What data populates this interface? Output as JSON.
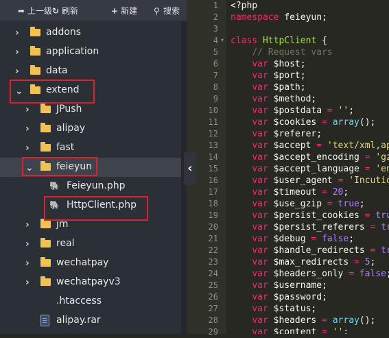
{
  "toolbar": {
    "up": "上一级",
    "refresh": "刷新",
    "new": "新建",
    "search": "搜索"
  },
  "tree": [
    {
      "label": "addons",
      "type": "folder",
      "depth": 0,
      "expanded": false
    },
    {
      "label": "application",
      "type": "folder",
      "depth": 0,
      "expanded": false
    },
    {
      "label": "data",
      "type": "folder",
      "depth": 0,
      "expanded": false
    },
    {
      "label": "extend",
      "type": "folder",
      "depth": 0,
      "expanded": true
    },
    {
      "label": "JPush",
      "type": "folder",
      "depth": 1,
      "expanded": false
    },
    {
      "label": "alipay",
      "type": "folder",
      "depth": 1,
      "expanded": false
    },
    {
      "label": "fast",
      "type": "folder",
      "depth": 1,
      "expanded": false
    },
    {
      "label": "feieyun",
      "type": "folder",
      "depth": 1,
      "expanded": true
    },
    {
      "label": "Feieyun.php",
      "type": "php",
      "depth": 2
    },
    {
      "label": "HttpClient.php",
      "type": "php",
      "depth": 2
    },
    {
      "label": "jm",
      "type": "folder",
      "depth": 1,
      "expanded": false
    },
    {
      "label": "real",
      "type": "folder",
      "depth": 1,
      "expanded": false
    },
    {
      "label": "wechatpay",
      "type": "folder",
      "depth": 1,
      "expanded": false
    },
    {
      "label": "wechatpayv3",
      "type": "folder",
      "depth": 1,
      "expanded": false
    },
    {
      "label": ".htaccess",
      "type": "file",
      "depth": 1
    },
    {
      "label": "alipay.rar",
      "type": "rar",
      "depth": 1
    }
  ],
  "editor": {
    "lines": [
      [
        [
          "p",
          "<?php"
        ]
      ],
      [
        [
          "kw",
          "namespace"
        ],
        [
          "p",
          " feieyun;"
        ]
      ],
      [],
      [
        [
          "kw",
          "class"
        ],
        [
          "p",
          " "
        ],
        [
          "cls",
          "HttpClient"
        ],
        [
          "p",
          " {"
        ]
      ],
      [
        [
          "p",
          "    "
        ],
        [
          "cm",
          "// Request vars"
        ]
      ],
      [
        [
          "p",
          "    "
        ],
        [
          "kw",
          "var"
        ],
        [
          "p",
          " $host;"
        ]
      ],
      [
        [
          "p",
          "    "
        ],
        [
          "kw",
          "var"
        ],
        [
          "p",
          " $port;"
        ]
      ],
      [
        [
          "p",
          "    "
        ],
        [
          "kw",
          "var"
        ],
        [
          "p",
          " $path;"
        ]
      ],
      [
        [
          "p",
          "    "
        ],
        [
          "kw",
          "var"
        ],
        [
          "p",
          " $method;"
        ]
      ],
      [
        [
          "p",
          "    "
        ],
        [
          "kw",
          "var"
        ],
        [
          "p",
          " $postdata "
        ],
        [
          "kw",
          "="
        ],
        [
          "p",
          " "
        ],
        [
          "st",
          "''"
        ],
        [
          "p",
          ";"
        ]
      ],
      [
        [
          "p",
          "    "
        ],
        [
          "kw",
          "var"
        ],
        [
          "p",
          " $cookies "
        ],
        [
          "kw",
          "="
        ],
        [
          "p",
          " "
        ],
        [
          "fn",
          "array"
        ],
        [
          "p",
          "();"
        ]
      ],
      [
        [
          "p",
          "    "
        ],
        [
          "kw",
          "var"
        ],
        [
          "p",
          " $referer;"
        ]
      ],
      [
        [
          "p",
          "    "
        ],
        [
          "kw",
          "var"
        ],
        [
          "p",
          " $accept "
        ],
        [
          "kw",
          "="
        ],
        [
          "p",
          " "
        ],
        [
          "st",
          "'text/xml,ap"
        ]
      ],
      [
        [
          "p",
          "    "
        ],
        [
          "kw",
          "var"
        ],
        [
          "p",
          " $accept_encoding "
        ],
        [
          "kw",
          "="
        ],
        [
          "p",
          " "
        ],
        [
          "st",
          "'gz"
        ]
      ],
      [
        [
          "p",
          "    "
        ],
        [
          "kw",
          "var"
        ],
        [
          "p",
          " $accept_language "
        ],
        [
          "kw",
          "="
        ],
        [
          "p",
          " "
        ],
        [
          "st",
          "'en"
        ]
      ],
      [
        [
          "p",
          "    "
        ],
        [
          "kw",
          "var"
        ],
        [
          "p",
          " $user_agent "
        ],
        [
          "kw",
          "="
        ],
        [
          "p",
          " "
        ],
        [
          "st",
          "'Incutio"
        ]
      ],
      [
        [
          "p",
          "    "
        ],
        [
          "kw",
          "var"
        ],
        [
          "p",
          " $timeout "
        ],
        [
          "kw",
          "="
        ],
        [
          "p",
          " "
        ],
        [
          "nm",
          "20"
        ],
        [
          "p",
          ";"
        ]
      ],
      [
        [
          "p",
          "    "
        ],
        [
          "kw",
          "var"
        ],
        [
          "p",
          " $use_gzip "
        ],
        [
          "kw",
          "="
        ],
        [
          "p",
          " "
        ],
        [
          "ct",
          "true"
        ],
        [
          "p",
          ";"
        ]
      ],
      [
        [
          "p",
          "    "
        ],
        [
          "kw",
          "var"
        ],
        [
          "p",
          " $persist_cookies "
        ],
        [
          "kw",
          "="
        ],
        [
          "p",
          " "
        ],
        [
          "ct",
          "tru"
        ]
      ],
      [
        [
          "p",
          "    "
        ],
        [
          "kw",
          "var"
        ],
        [
          "p",
          " $persist_referers "
        ],
        [
          "kw",
          "="
        ],
        [
          "p",
          " "
        ],
        [
          "ct",
          "tr"
        ]
      ],
      [
        [
          "p",
          "    "
        ],
        [
          "kw",
          "var"
        ],
        [
          "p",
          " $debug "
        ],
        [
          "kw",
          "="
        ],
        [
          "p",
          " "
        ],
        [
          "ct",
          "false"
        ],
        [
          "p",
          ";"
        ]
      ],
      [
        [
          "p",
          "    "
        ],
        [
          "kw",
          "var"
        ],
        [
          "p",
          " $handle_redirects "
        ],
        [
          "kw",
          "="
        ],
        [
          "p",
          " "
        ],
        [
          "ct",
          "tr"
        ]
      ],
      [
        [
          "p",
          "    "
        ],
        [
          "kw",
          "var"
        ],
        [
          "p",
          " $max_redirects "
        ],
        [
          "kw",
          "="
        ],
        [
          "p",
          " "
        ],
        [
          "nm",
          "5"
        ],
        [
          "p",
          ";"
        ]
      ],
      [
        [
          "p",
          "    "
        ],
        [
          "kw",
          "var"
        ],
        [
          "p",
          " $headers_only "
        ],
        [
          "kw",
          "="
        ],
        [
          "p",
          " "
        ],
        [
          "ct",
          "false"
        ],
        [
          "p",
          ";"
        ]
      ],
      [
        [
          "p",
          "    "
        ],
        [
          "kw",
          "var"
        ],
        [
          "p",
          " $username;"
        ]
      ],
      [
        [
          "p",
          "    "
        ],
        [
          "kw",
          "var"
        ],
        [
          "p",
          " $password;"
        ]
      ],
      [
        [
          "p",
          "    "
        ],
        [
          "kw",
          "var"
        ],
        [
          "p",
          " $status;"
        ]
      ],
      [
        [
          "p",
          "    "
        ],
        [
          "kw",
          "var"
        ],
        [
          "p",
          " $headers "
        ],
        [
          "kw",
          "="
        ],
        [
          "p",
          " "
        ],
        [
          "fn",
          "array"
        ],
        [
          "p",
          "();"
        ]
      ],
      [
        [
          "p",
          "    "
        ],
        [
          "kw",
          "var"
        ],
        [
          "p",
          " $content "
        ],
        [
          "kw",
          "="
        ],
        [
          "p",
          " "
        ],
        [
          "st",
          "''"
        ],
        [
          "p",
          ";"
        ]
      ]
    ]
  }
}
